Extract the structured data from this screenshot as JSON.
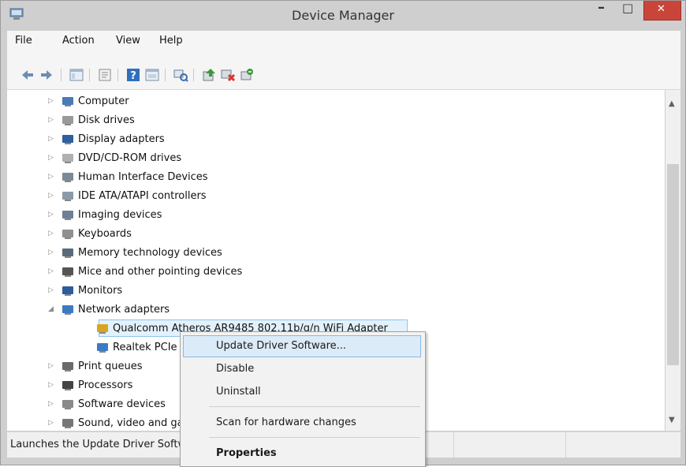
{
  "window": {
    "title": "Device Manager",
    "close_symbol": "✕",
    "min_symbol": "–",
    "max_symbol": "□"
  },
  "menu": [
    "File",
    "Action",
    "View",
    "Help"
  ],
  "toolbar": {
    "icons": [
      "back-arrow-icon",
      "forward-arrow-icon",
      "show-hide-console-tree-icon",
      "properties-icon",
      "help-icon",
      "show-details-icon",
      "scan-hardware-changes-icon",
      "update-driver-icon",
      "disable-device-icon",
      "uninstall-device-icon"
    ]
  },
  "tree": {
    "categories": [
      {
        "label": "Computer",
        "icon": "computer-icon"
      },
      {
        "label": "Disk drives",
        "icon": "disk-drive-icon"
      },
      {
        "label": "Display adapters",
        "icon": "display-adapter-icon"
      },
      {
        "label": "DVD/CD-ROM drives",
        "icon": "dvd-drive-icon"
      },
      {
        "label": "Human Interface Devices",
        "icon": "hid-icon"
      },
      {
        "label": "IDE ATA/ATAPI controllers",
        "icon": "ide-controller-icon"
      },
      {
        "label": "Imaging devices",
        "icon": "imaging-device-icon"
      },
      {
        "label": "Keyboards",
        "icon": "keyboard-icon"
      },
      {
        "label": "Memory technology devices",
        "icon": "memory-device-icon"
      },
      {
        "label": "Mice and other pointing devices",
        "icon": "mouse-icon"
      },
      {
        "label": "Monitors",
        "icon": "monitor-icon"
      },
      {
        "label": "Network adapters",
        "icon": "network-adapter-icon",
        "expanded": true
      }
    ],
    "network_children": [
      {
        "label": "Qualcomm Atheros AR9485 802.11b/g/n WiFi Adapter",
        "icon": "warning-network-adapter-icon",
        "selected": true
      },
      {
        "label": "Realtek PCIe GBE Family Controller",
        "icon": "network-adapter-icon"
      }
    ],
    "after_categories": [
      {
        "label": "Print queues",
        "icon": "printer-icon"
      },
      {
        "label": "Processors",
        "icon": "processor-icon"
      },
      {
        "label": "Software devices",
        "icon": "software-device-icon"
      },
      {
        "label": "Sound, video and game controllers",
        "icon": "sound-icon"
      }
    ]
  },
  "context_menu": {
    "items": [
      {
        "label": "Update Driver Software...",
        "highlighted": true
      },
      {
        "label": "Disable"
      },
      {
        "label": "Uninstall"
      },
      {
        "label": "Scan for hardware changes"
      },
      {
        "label": "Properties",
        "bold": true
      }
    ]
  },
  "statusbar": {
    "text": "Launches the Update Driver Software Wizard for the selected device."
  },
  "colors": {
    "selection_fill": "#e3f1fc",
    "selection_border": "#8ec5ea",
    "close_button": "#c9453a"
  }
}
